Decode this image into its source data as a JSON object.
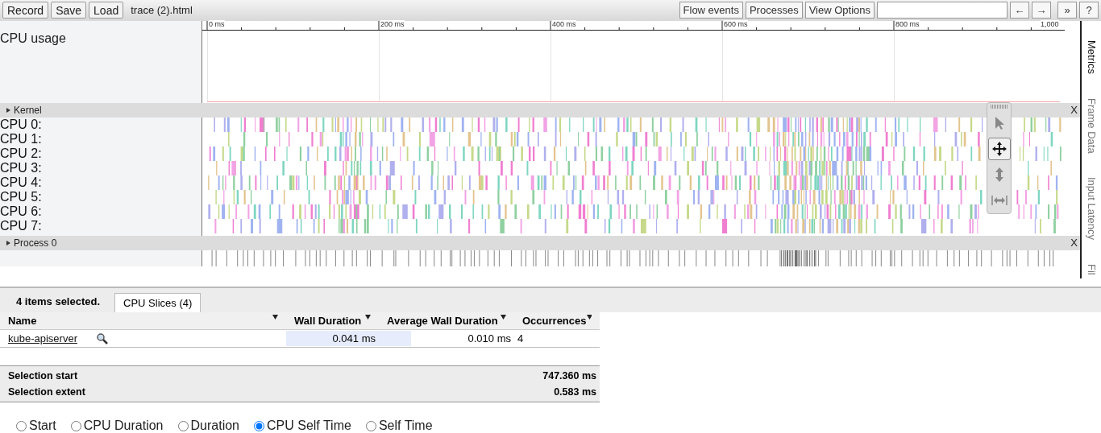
{
  "toolbar": {
    "buttons": [
      "Record",
      "Save",
      "Load"
    ],
    "filename": "trace (2).html",
    "right_buttons": [
      "Flow events",
      "Processes",
      "View Options"
    ],
    "nav_buttons": [
      "←",
      "→"
    ],
    "extra_buttons": [
      "»",
      "?"
    ]
  },
  "ruler": {
    "ticks": [
      "0 ms",
      "200 ms",
      "400 ms",
      "600 ms",
      "800 ms",
      "1,000"
    ]
  },
  "cpu_usage": {
    "label": "CPU usage"
  },
  "groups": [
    {
      "kind": "cpus",
      "title": "Kernel",
      "close": "X",
      "rows": [
        "CPU 0:",
        "CPU 1:",
        "CPU 2:",
        "CPU 3:",
        "CPU 4:",
        "CPU 5:",
        "CPU 6:",
        "CPU 7:"
      ]
    },
    {
      "kind": "process",
      "title": "Process 0",
      "close": "X"
    }
  ],
  "tools": [
    {
      "kind": "select",
      "selected": false
    },
    {
      "kind": "pan",
      "selected": true
    },
    {
      "kind": "zoom",
      "selected": false
    },
    {
      "kind": "timing",
      "selected": false
    }
  ],
  "side_tabs": [
    {
      "label": "Metrics",
      "selected": true
    },
    {
      "label": "Frame Data",
      "selected": false
    },
    {
      "label": "Input Latency",
      "selected": false
    },
    {
      "label": "Fil",
      "selected": false
    }
  ],
  "selection": {
    "summary": "4 items selected.",
    "tabs": [
      {
        "label": "CPU Slices (4)",
        "selected": true
      }
    ]
  },
  "table": {
    "columns": [
      "Name",
      "Wall Duration",
      "Average Wall Duration",
      "Occurrences"
    ],
    "rows": [
      {
        "name": "kube-apiserver",
        "wall": "0.041 ms",
        "wall_bar": {
          "level": 1
        },
        "avg": "0.010 ms",
        "avg_bar": {
          "level": 0.24
        },
        "occurrences": "4"
      }
    ]
  },
  "summary": [
    {
      "label": "Selection start",
      "value": "747.360 ms"
    },
    {
      "label": "Selection extent",
      "value": "0.583 ms"
    }
  ],
  "radios": [
    {
      "label": "Start",
      "selected": false
    },
    {
      "label": "CPU Duration",
      "selected": false
    },
    {
      "label": "Duration",
      "selected": false
    },
    {
      "label": "CPU Self Time",
      "selected": true
    },
    {
      "label": "Self Time",
      "selected": false
    }
  ]
}
